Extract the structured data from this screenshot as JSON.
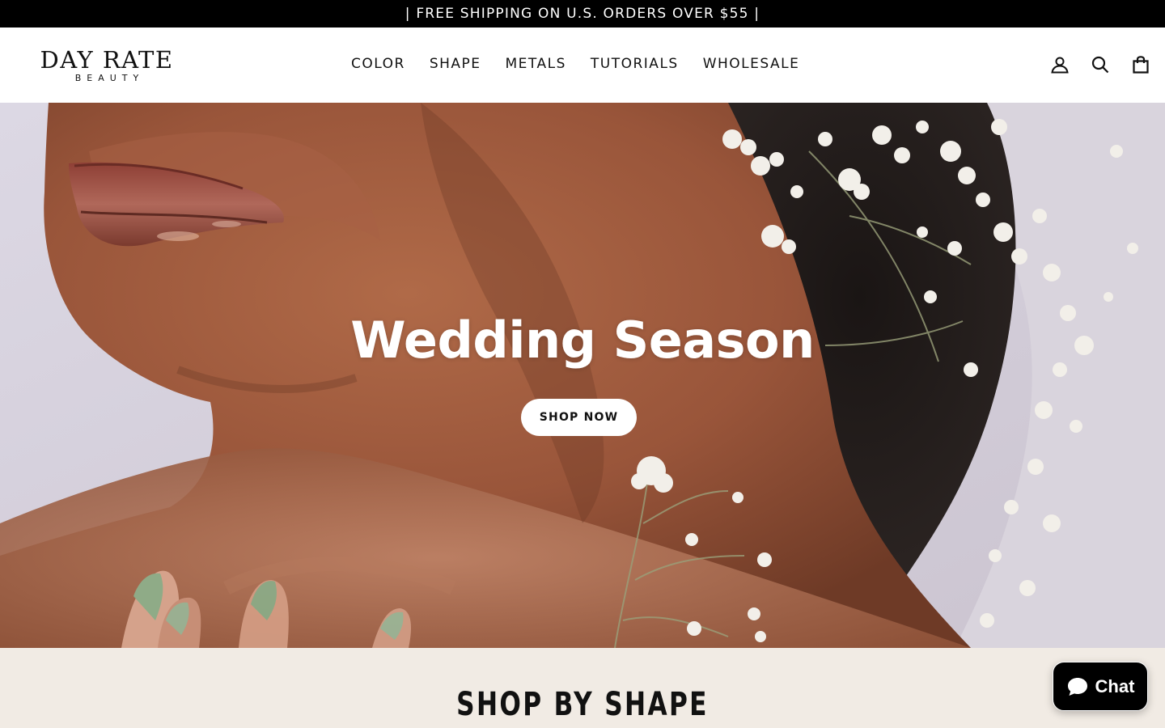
{
  "announcement": {
    "text": "| FREE SHIPPING ON U.S. ORDERS OVER $55 |"
  },
  "brand": {
    "name": "DAY RATE",
    "sub": "BEAUTY"
  },
  "nav": {
    "items": [
      {
        "label": "COLOR"
      },
      {
        "label": "SHAPE"
      },
      {
        "label": "METALS"
      },
      {
        "label": "TUTORIALS"
      },
      {
        "label": "WHOLESALE"
      }
    ]
  },
  "header_icons": [
    "account-icon",
    "search-icon",
    "cart-icon"
  ],
  "hero": {
    "title": "Wedding Season",
    "cta_label": "SHOP NOW"
  },
  "shape_section": {
    "title": "SHOP BY SHAPE"
  },
  "chat": {
    "label": "Chat",
    "icon": "chat-bubble-icon"
  },
  "colors": {
    "announcement_bg": "#000000",
    "section_bg": "#f1ebe4",
    "chat_bg": "#000000"
  }
}
